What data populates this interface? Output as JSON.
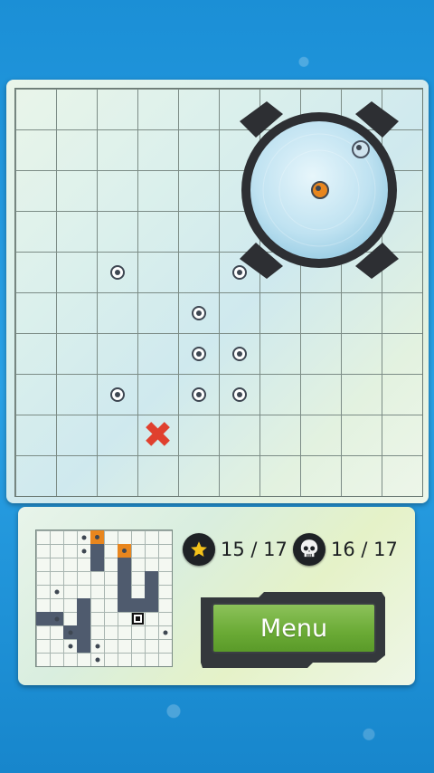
{
  "board": {
    "rows": 10,
    "cols": 10,
    "pegs": [
      {
        "col": 2,
        "row": 4
      },
      {
        "col": 5,
        "row": 4
      },
      {
        "col": 4,
        "row": 5
      },
      {
        "col": 4,
        "row": 6
      },
      {
        "col": 5,
        "row": 6
      },
      {
        "col": 2,
        "row": 7
      },
      {
        "col": 4,
        "row": 7
      },
      {
        "col": 5,
        "row": 7
      }
    ],
    "target": {
      "col": 3,
      "row": 8
    }
  },
  "magnifier": {
    "pegs": [
      {
        "kind": "normal",
        "col": 8,
        "row": 1
      },
      {
        "kind": "orange",
        "col": 7,
        "row": 2
      }
    ]
  },
  "minimap": {
    "cols": 10,
    "rows": 10,
    "walls": [
      {
        "col": 4,
        "row": 1
      },
      {
        "col": 4,
        "row": 2
      },
      {
        "col": 6,
        "row": 2
      },
      {
        "col": 6,
        "row": 3
      },
      {
        "col": 6,
        "row": 4
      },
      {
        "col": 6,
        "row": 5
      },
      {
        "col": 8,
        "row": 3
      },
      {
        "col": 8,
        "row": 4
      },
      {
        "col": 8,
        "row": 5
      },
      {
        "col": 7,
        "row": 5
      },
      {
        "col": 0,
        "row": 6
      },
      {
        "col": 1,
        "row": 6
      },
      {
        "col": 3,
        "row": 5
      },
      {
        "col": 3,
        "row": 6
      },
      {
        "col": 3,
        "row": 7
      },
      {
        "col": 3,
        "row": 8
      },
      {
        "col": 2,
        "row": 7
      }
    ],
    "orange": [
      {
        "col": 4,
        "row": 0
      },
      {
        "col": 6,
        "row": 1
      }
    ],
    "dots": [
      {
        "col": 3,
        "row": 0
      },
      {
        "col": 3,
        "row": 1
      },
      {
        "col": 1,
        "row": 4
      },
      {
        "col": 1,
        "row": 6
      },
      {
        "col": 2,
        "row": 8
      },
      {
        "col": 2,
        "row": 7
      },
      {
        "col": 4,
        "row": 8
      },
      {
        "col": 4,
        "row": 9
      },
      {
        "col": 9,
        "row": 7
      }
    ],
    "cursor": {
      "col": 7,
      "row": 6
    }
  },
  "stats": {
    "stars": "15 / 17",
    "deaths": "16 / 17"
  },
  "menu": {
    "label": "Menu"
  },
  "colors": {
    "peg": "#3e4752",
    "target": "#e0402e",
    "orange": "#e8861e",
    "button": "#6aaa35"
  },
  "icons": {
    "star": "star-icon",
    "deaths": "skull-icon"
  }
}
